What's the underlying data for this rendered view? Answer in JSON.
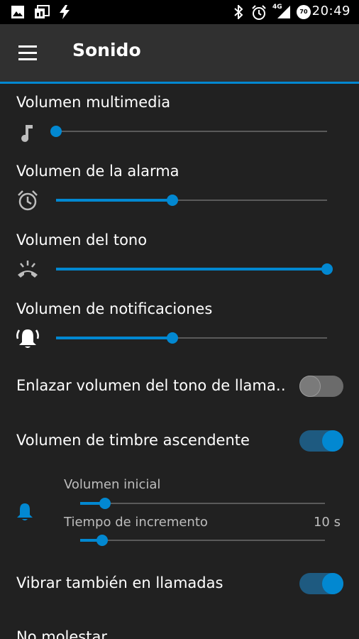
{
  "status_bar": {
    "time": "20:49",
    "network": "4G",
    "battery": "70",
    "icons": [
      "image-icon",
      "photo-library-icon",
      "flash-icon",
      "bluetooth-icon",
      "alarm-icon",
      "signal-icon",
      "battery-icon"
    ]
  },
  "app_bar": {
    "title": "Sonido",
    "menu_icon": "menu-icon"
  },
  "colors": {
    "accent": "#0288d1",
    "background": "#212121",
    "app_bar": "#303030"
  },
  "settings": {
    "media_volume": {
      "label": "Volumen multimedia",
      "icon": "music-note-icon",
      "level": 0.0
    },
    "alarm_volume": {
      "label": "Volumen de la alarma",
      "icon": "alarm-icon",
      "level": 0.43
    },
    "ring_volume": {
      "label": "Volumen del tono",
      "icon": "ringing-phone-icon",
      "level": 1.0
    },
    "notification_volume": {
      "label": "Volumen de notificaciones",
      "icon": "bell-ringing-icon",
      "level": 0.43
    },
    "link_ring_volume": {
      "label": "Enlazar volumen del tono de llama‥",
      "enabled": false
    },
    "ascending_ringer": {
      "label": "Volumen de timbre ascendente",
      "enabled": true
    },
    "ascending_details": {
      "icon": "bell-icon",
      "initial_volume": {
        "label": "Volumen inicial",
        "level": 0.1
      },
      "increment_time": {
        "label": "Tiempo de incremento",
        "value": "10 s",
        "level": 0.09
      }
    },
    "vibrate_calls": {
      "label": "Vibrar también en llamadas",
      "enabled": true
    },
    "do_not_disturb": {
      "label": "No molestar"
    }
  }
}
